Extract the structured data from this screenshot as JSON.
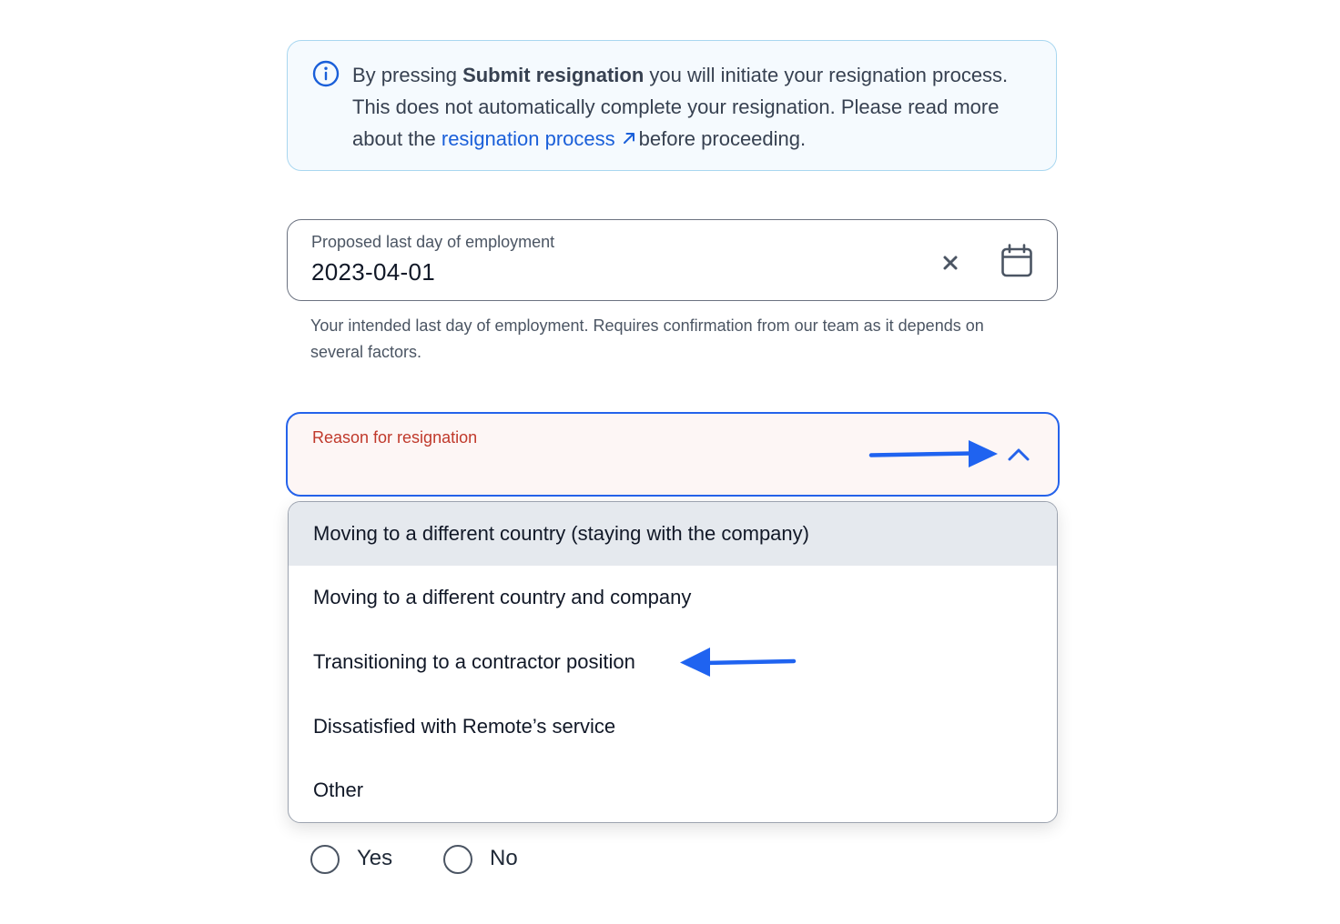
{
  "info_banner": {
    "text_before": "By pressing ",
    "bold_text": "Submit resignation",
    "text_middle": " you will initiate your resignation process. This does not automatically complete your resignation. Please read more about the ",
    "link_text": "resignation process",
    "text_after": "before proceeding.",
    "icon": "info-icon",
    "link_icon": "external-link-icon"
  },
  "date_field": {
    "label": "Proposed last day of employment",
    "value": "2023-04-01",
    "helper": "Your intended last day of employment. Requires confirmation from our team as it depends on several factors.",
    "clear_icon": "close-icon",
    "calendar_icon": "calendar-icon"
  },
  "reason_select": {
    "label": "Reason for resignation",
    "icon": "chevron-up-icon",
    "options": [
      "Moving to a different country (staying with the company)",
      "Moving to a different country and company",
      "Transitioning to a contractor position",
      "Dissatisfied with Remote’s service",
      "Other"
    ],
    "highlighted_option": "Moving to a different country (staying with the company)"
  },
  "radio_group": {
    "options": [
      "Yes",
      "No"
    ]
  },
  "colors": {
    "accent": "#2563eb",
    "link": "#1a5fd9",
    "error_label": "#c0392b",
    "banner_bg": "#f5fafe",
    "annotation_arrow": "#1f63f0"
  }
}
